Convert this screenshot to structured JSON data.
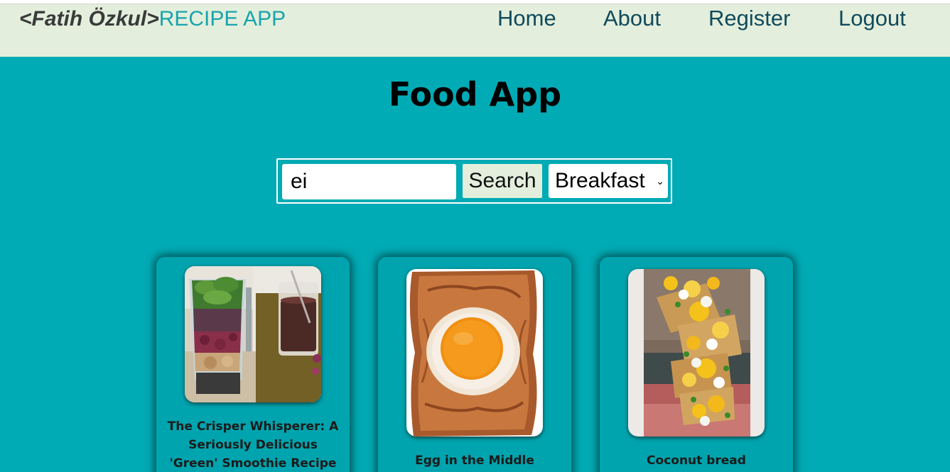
{
  "navbar": {
    "brand_name": "<Fatih Özkul>",
    "brand_app": "RECIPE APP",
    "links": [
      "Home",
      "About",
      "Register",
      "Logout"
    ]
  },
  "main": {
    "title": "Food App",
    "search": {
      "value": "ei",
      "button_label": "Search",
      "category_selected": "Breakfast"
    },
    "recipes": [
      {
        "title": "The Crisper Whisperer: A Seriously Delicious 'Green' Smoothie Recipe"
      },
      {
        "title": "Egg in the Middle"
      },
      {
        "title": "Coconut bread"
      }
    ]
  },
  "colors": {
    "background": "#00abb5",
    "navbar": "#e3efdc",
    "brand_accent": "#1aa3ad",
    "nav_link": "#104a5c"
  }
}
